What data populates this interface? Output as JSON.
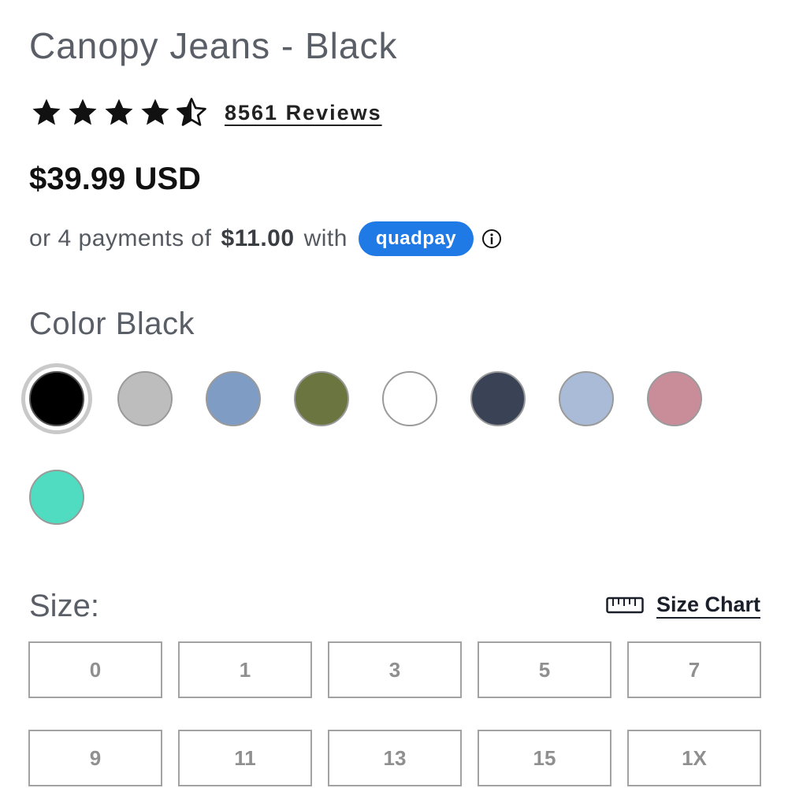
{
  "product": {
    "title": "Canopy Jeans - Black",
    "rating": 4.5,
    "rating_max": 5,
    "reviews_text": "8561 Reviews",
    "price": "$39.99 USD"
  },
  "installments": {
    "prefix": "or 4 payments of",
    "amount": "$11.00",
    "suffix": "with",
    "provider": "quadpay"
  },
  "color": {
    "label": "Color Black",
    "selected_index": 0,
    "swatches": [
      {
        "name": "Black",
        "hex": "#000000"
      },
      {
        "name": "Grey",
        "hex": "#bdbdbd"
      },
      {
        "name": "Light Wash Blue",
        "hex": "#7f9cc5"
      },
      {
        "name": "Olive",
        "hex": "#6b7540"
      },
      {
        "name": "White",
        "hex": "#ffffff"
      },
      {
        "name": "Dark Wash",
        "hex": "#3a4356"
      },
      {
        "name": "Light Blue",
        "hex": "#a9bbd6"
      },
      {
        "name": "Pink",
        "hex": "#c98d9a"
      },
      {
        "name": "Aqua",
        "hex": "#4fdcc0"
      }
    ]
  },
  "size": {
    "label": "Size:",
    "chart_link": "Size Chart",
    "options": [
      "0",
      "1",
      "3",
      "5",
      "7",
      "9",
      "11",
      "13",
      "15",
      "1X"
    ]
  }
}
